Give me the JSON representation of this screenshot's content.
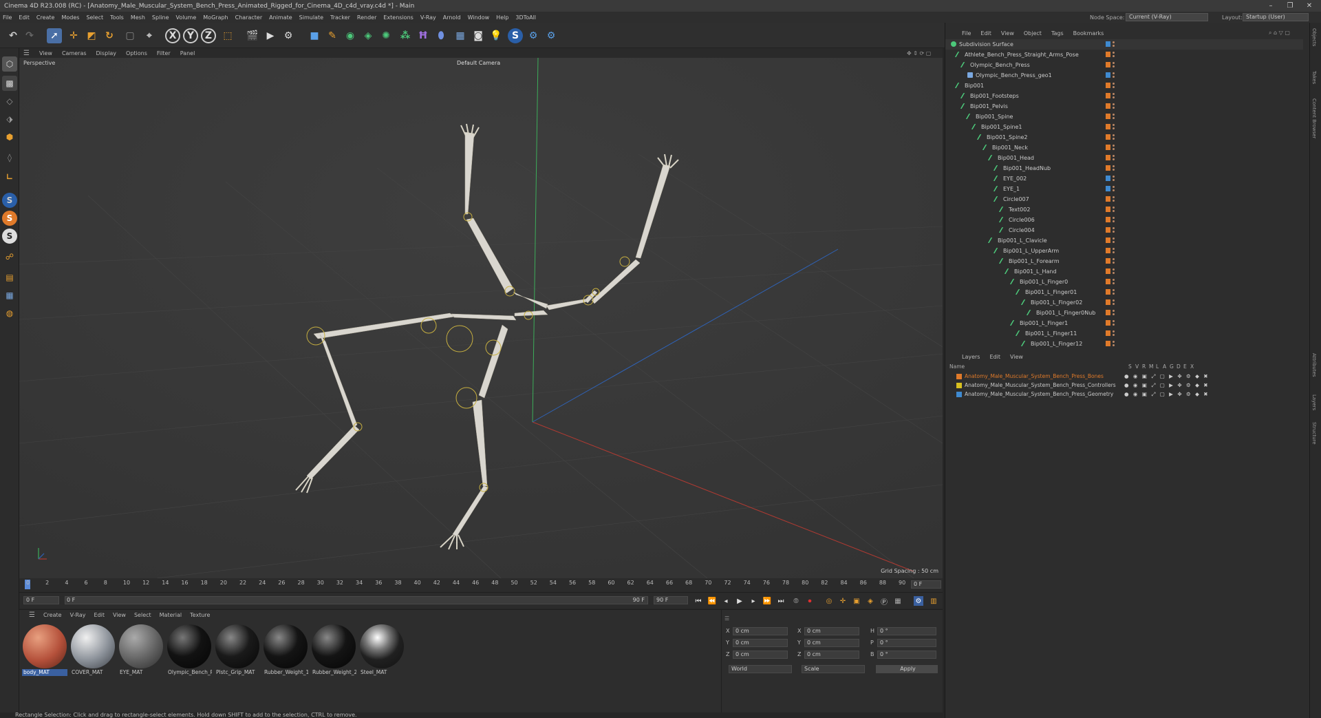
{
  "window": {
    "title": "Cinema 4D R23.008 (RC) - [Anatomy_Male_Muscular_System_Bench_Press_Animated_Rigged_for_Cinema_4D_c4d_vray.c4d *] - Main",
    "controls": [
      "–",
      "❐",
      "✕"
    ]
  },
  "menubar": {
    "items": [
      "File",
      "Edit",
      "Create",
      "Modes",
      "Select",
      "Tools",
      "Mesh",
      "Spline",
      "Volume",
      "MoGraph",
      "Character",
      "Animate",
      "Simulate",
      "Tracker",
      "Render",
      "Extensions",
      "V-Ray",
      "Arnold",
      "Window",
      "Help",
      "3DToAll"
    ],
    "node_space_label": "Node Space:",
    "node_space_value": "Current (V-Ray)",
    "layout_label": "Layout:",
    "layout_value": "Startup (User)"
  },
  "toolbar": {
    "axis_x": "X",
    "axis_y": "Y",
    "axis_z": "Z"
  },
  "viewport": {
    "menu": [
      "View",
      "Cameras",
      "Display",
      "Options",
      "Filter",
      "Panel"
    ],
    "projection": "Perspective",
    "camera": "Default Camera",
    "grid_spacing": "Grid Spacing : 50 cm"
  },
  "timeline": {
    "ticks": [
      "0",
      "2",
      "4",
      "6",
      "8",
      "10",
      "12",
      "14",
      "16",
      "18",
      "20",
      "22",
      "24",
      "26",
      "28",
      "30",
      "32",
      "34",
      "36",
      "38",
      "40",
      "42",
      "44",
      "46",
      "48",
      "50",
      "52",
      "54",
      "56",
      "58",
      "60",
      "62",
      "64",
      "66",
      "68",
      "70",
      "72",
      "74",
      "76",
      "78",
      "80",
      "82",
      "84",
      "86",
      "88",
      "90"
    ],
    "current_frame_display": "0 F",
    "start_frame": "0 F",
    "min_frame": "0 F",
    "max_frame": "90 F",
    "end_frame": "90 F"
  },
  "materials": {
    "menu": [
      "Create",
      "V-Ray",
      "Edit",
      "View",
      "Select",
      "Material",
      "Texture"
    ],
    "items": [
      {
        "name": "body_MAT",
        "color": "#b4503a"
      },
      {
        "name": "COVER_MAT",
        "color": "#8a9098"
      },
      {
        "name": "EYE_MAT",
        "color": "#606060"
      },
      {
        "name": "Olympic_Bench_P",
        "color": "#121212"
      },
      {
        "name": "Plstc_Grip_MAT",
        "color": "#1a1a1a"
      },
      {
        "name": "Rubber_Weight_1",
        "color": "#141414"
      },
      {
        "name": "Rubber_Weight_2",
        "color": "#141414"
      },
      {
        "name": "Steel_MAT",
        "color": "#202020"
      }
    ]
  },
  "coordinates": {
    "pos_labels": [
      "X",
      "Y",
      "Z"
    ],
    "pos_values": [
      "0 cm",
      "0 cm",
      "0 cm"
    ],
    "size_labels": [
      "X",
      "Y",
      "Z"
    ],
    "size_values": [
      "0 cm",
      "0 cm",
      "0 cm"
    ],
    "rot_labels": [
      "H",
      "P",
      "B"
    ],
    "rot_values": [
      "0 °",
      "0 °",
      "0 °"
    ],
    "mode": "World",
    "size_mode": "Scale",
    "apply_label": "Apply"
  },
  "status": "Rectangle Selection: Click and drag to rectangle-select elements. Hold down SHIFT to add to the selection, CTRL to remove.",
  "object_manager": {
    "menu": [
      "File",
      "Edit",
      "View",
      "Object",
      "Tags",
      "Bookmarks"
    ],
    "rows": [
      {
        "name": "Subdivision Surface",
        "indent": 0
      },
      {
        "name": "Athlete_Bench_Press_Straight_Arms_Pose",
        "indent": 1
      },
      {
        "name": "Olympic_Bench_Press",
        "indent": 2
      },
      {
        "name": "Olympic_Bench_Press_geo1",
        "indent": 3
      },
      {
        "name": "Bip001",
        "indent": 1
      },
      {
        "name": "Bip001_Footsteps",
        "indent": 2
      },
      {
        "name": "Bip001_Pelvis",
        "indent": 2
      },
      {
        "name": "Bip001_Spine",
        "indent": 3
      },
      {
        "name": "Bip001_Spine1",
        "indent": 4
      },
      {
        "name": "Bip001_Spine2",
        "indent": 5
      },
      {
        "name": "Bip001_Neck",
        "indent": 6
      },
      {
        "name": "Bip001_Head",
        "indent": 7
      },
      {
        "name": "Bip001_HeadNub",
        "indent": 8
      },
      {
        "name": "EYE_002",
        "indent": 8
      },
      {
        "name": "EYE_1",
        "indent": 8
      },
      {
        "name": "Circle007",
        "indent": 8
      },
      {
        "name": "Text002",
        "indent": 9
      },
      {
        "name": "Circle006",
        "indent": 9
      },
      {
        "name": "Circle004",
        "indent": 9
      },
      {
        "name": "Bip001_L_Clavicle",
        "indent": 7
      },
      {
        "name": "Bip001_L_UpperArm",
        "indent": 8
      },
      {
        "name": "Bip001_L_Forearm",
        "indent": 9
      },
      {
        "name": "Bip001_L_Hand",
        "indent": 10
      },
      {
        "name": "Bip001_L_Finger0",
        "indent": 11
      },
      {
        "name": "Bip001_L_Finger01",
        "indent": 12
      },
      {
        "name": "Bip001_L_Finger02",
        "indent": 13
      },
      {
        "name": "Bip001_L_Finger0Nub",
        "indent": 14
      },
      {
        "name": "Bip001_L_Finger1",
        "indent": 11
      },
      {
        "name": "Bip001_L_Finger11",
        "indent": 12
      },
      {
        "name": "Bip001_L_Finger12",
        "indent": 13
      }
    ]
  },
  "layers": {
    "menu": [
      "Layers",
      "Edit",
      "View"
    ],
    "name_header": "Name",
    "column_headers": [
      "S",
      "V",
      "R",
      "M",
      "L",
      "A",
      "G",
      "D",
      "E",
      "X"
    ],
    "items": [
      {
        "name": "Anatomy_Male_Muscular_System_Bench_Press_Bones",
        "color": "#e07a2a",
        "text_color": "#e07a2a"
      },
      {
        "name": "Anatomy_Male_Muscular_System_Bench_Press_Controllers",
        "color": "#d8c020",
        "text_color": "#c8c8c8"
      },
      {
        "name": "Anatomy_Male_Muscular_System_Bench_Press_Geometry",
        "color": "#3f8ad0",
        "text_color": "#c8c8c8"
      }
    ]
  },
  "side_tabs": [
    "Objects",
    "Takes",
    "Content Browser",
    "Attributes",
    "Layers",
    "Structure"
  ]
}
